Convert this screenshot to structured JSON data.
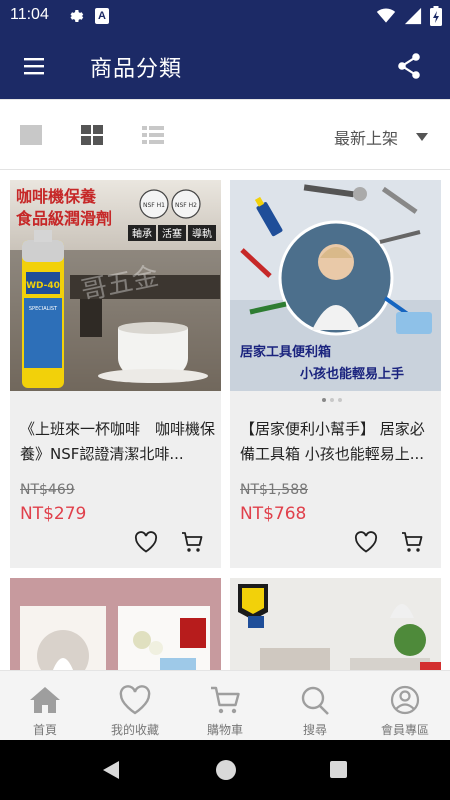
{
  "status_bar": {
    "time": "11:04",
    "keyboard_glyph": "A"
  },
  "app_bar": {
    "title": "商品分類"
  },
  "toolbar": {
    "sort_label": "最新上架"
  },
  "products": [
    {
      "name": "《上班來一杯咖啡　咖啡機保養》NSF認證清潔北啡...",
      "old_price": "NT$469",
      "price": "NT$279",
      "image": {
        "headline_1": "咖啡機保養",
        "headline_2": "食品級潤滑劑",
        "badge_1": "NSF H1",
        "badge_2": "NSF H2",
        "tags": [
          "軸承",
          "活塞",
          "導軌"
        ],
        "can_brand": "WD-40",
        "can_line": "SPECIALIST",
        "watermark": "哥五金"
      }
    },
    {
      "name": "【居家便利小幫手】 居家必備工具箱 小孩也能輕易上...",
      "old_price": "NT$1,588",
      "price": "NT$768",
      "image": {
        "caption_1": "居家工具便利箱",
        "caption_2": "小孩也能輕易上手"
      }
    }
  ],
  "bottom_nav": [
    {
      "label": "首頁",
      "icon": "home-icon"
    },
    {
      "label": "我的收藏",
      "icon": "heart-icon"
    },
    {
      "label": "購物車",
      "icon": "cart-icon"
    },
    {
      "label": "搜尋",
      "icon": "search-icon"
    },
    {
      "label": "會員專區",
      "icon": "user-icon"
    }
  ],
  "colors": {
    "primary": "#1c2a66",
    "price": "#e0404b",
    "card_bg": "#efefef"
  }
}
